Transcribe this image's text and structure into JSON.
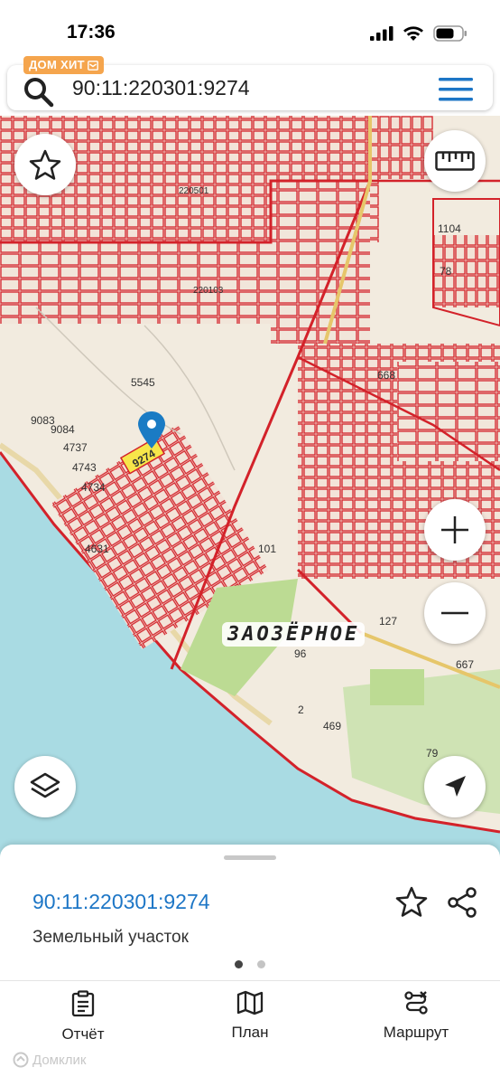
{
  "status_bar": {
    "time": "17:36"
  },
  "search": {
    "value": "90:11:220301:9274",
    "brand_badge": "ДОМ ХИТ"
  },
  "map": {
    "place_name": "ЗАОЗЁРНОЕ",
    "highlighted_parcel_label": "9274",
    "parcel_labels": [
      "5545",
      "1104",
      "78",
      "668",
      "101",
      "127",
      "667",
      "96",
      "2",
      "469",
      "79",
      "9083",
      "9084",
      "4737",
      "4743",
      "4734",
      "4631",
      "220501",
      "220103"
    ],
    "colors": {
      "parcel_outline": "#d3222a",
      "highlight": "#f7e64a",
      "water": "#a9dbe3",
      "land": "#f2ebdf",
      "green": "#bcdb93",
      "marker": "#1a7bc4"
    }
  },
  "card": {
    "title": "90:11:220301:9274",
    "subtitle": "Земельный участок"
  },
  "bottom_nav": [
    {
      "label": "Отчёт",
      "icon": "clipboard-icon"
    },
    {
      "label": "План",
      "icon": "map-icon"
    },
    {
      "label": "Маршрут",
      "icon": "route-icon"
    }
  ],
  "watermark": "Домклик"
}
